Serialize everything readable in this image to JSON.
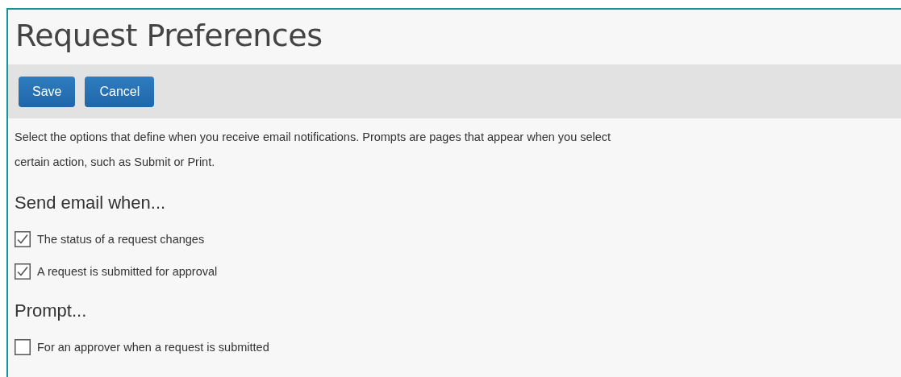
{
  "page": {
    "title": "Request Preferences"
  },
  "toolbar": {
    "buttons": [
      {
        "label": "Save"
      },
      {
        "label": "Cancel"
      }
    ]
  },
  "description_lines": [
    "Select the options that define when you receive email notifications. Prompts are pages that appear when you select",
    "certain action, such as Submit or Print."
  ],
  "sections": [
    {
      "heading": "Send email when...",
      "options": [
        {
          "label": "The status of a request changes",
          "checked": true
        },
        {
          "label": "A request is submitted for approval",
          "checked": true
        }
      ]
    },
    {
      "heading": "Prompt...",
      "options": [
        {
          "label": "For an approver when a request is submitted",
          "checked": false
        }
      ]
    }
  ]
}
